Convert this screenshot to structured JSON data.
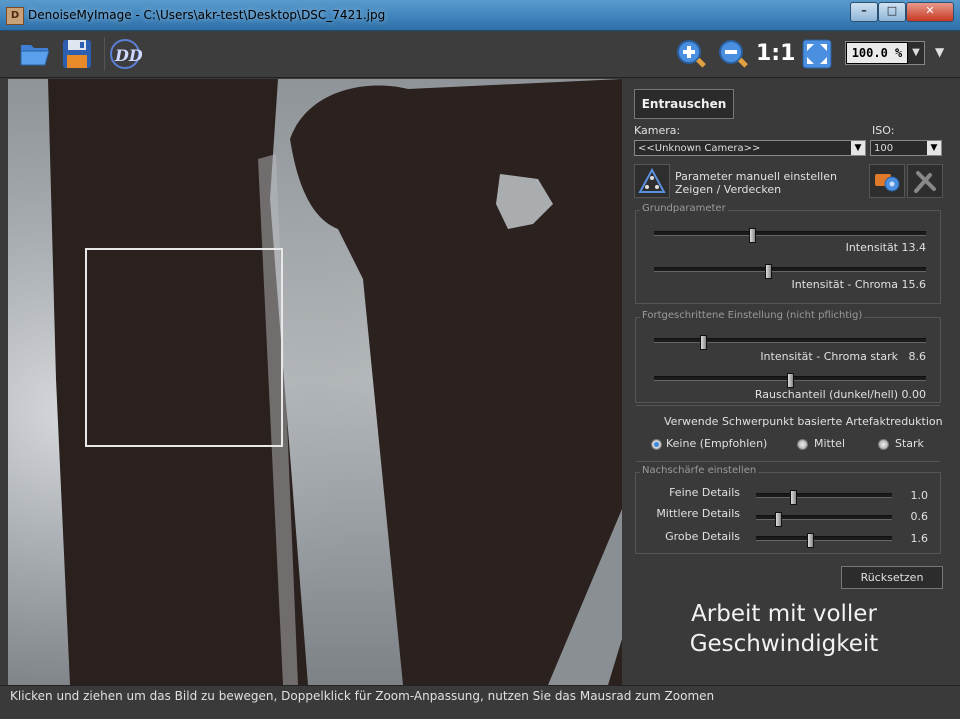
{
  "window": {
    "title": "DenoiseMyImage - C:\\Users\\akr-test\\Desktop\\DSC_7421.jpg",
    "icon_letter": "D",
    "controls": {
      "minimize": "–",
      "maximize": "□",
      "close": "✕"
    }
  },
  "toolbar": {
    "icons": [
      "open-folder-icon",
      "save-disk-icon",
      "app-logo-icon",
      "zoom-in-icon",
      "zoom-out-icon",
      "zoom-actual-icon",
      "zoom-fit-icon"
    ],
    "actual_size_label": "1:1",
    "zoom": {
      "value": "100.0 %",
      "dropdown": "▼"
    },
    "menu_arrow": "▼"
  },
  "panel": {
    "denoise_button": "Entrauschen",
    "camera": {
      "label": "Kamera:",
      "value": "<<Unknown Camera>>"
    },
    "iso": {
      "label": "ISO:",
      "value": "100"
    },
    "manual_params": {
      "line1": "Parameter manuell einstellen",
      "line2": "Zeigen / Verdecken"
    },
    "basic": {
      "title": "Grundparameter",
      "sliders": [
        {
          "label": "Intensität",
          "value": "13.4",
          "fraction": 0.36
        },
        {
          "label": "Intensität - Chroma",
          "value": "15.6",
          "fraction": 0.42
        }
      ]
    },
    "advanced": {
      "title": "Fortgeschrittene Einstellung (nicht pflichtig)",
      "sliders": [
        {
          "label": "Intensität - Chroma stark",
          "value": "8.6",
          "fraction": 0.18
        },
        {
          "label": "Rauschanteil (dunkel/hell)",
          "value": "0.00",
          "fraction": 0.5
        }
      ]
    },
    "artifact": {
      "label": "Verwende Schwerpunkt basierte Artefaktreduktion",
      "options": [
        {
          "label": "Keine (Empfohlen)",
          "selected": true
        },
        {
          "label": "Mittel",
          "selected": false
        },
        {
          "label": "Stark",
          "selected": false
        }
      ]
    },
    "sharpen": {
      "title": "Nachschärfe einstellen",
      "sliders": [
        {
          "label": "Feine Details",
          "value": "1.0",
          "fraction": 0.27
        },
        {
          "label": "Mittlere Details",
          "value": "0.6",
          "fraction": 0.16
        },
        {
          "label": "Grobe Details",
          "value": "1.6",
          "fraction": 0.4
        }
      ]
    },
    "reset_button": "Rücksetzen",
    "speed_text_line1": "Arbeit mit voller",
    "speed_text_line2": "Geschwindigkeit"
  },
  "status": {
    "text": "Klicken und ziehen um das Bild zu bewegen, Doppelklick für Zoom-Anpassung, nutzen Sie das Mausrad zum Zoomen"
  },
  "colors": {
    "accent": "#3d8be0",
    "background": "#3a3a3a",
    "titlebar": "#3d82ba"
  }
}
